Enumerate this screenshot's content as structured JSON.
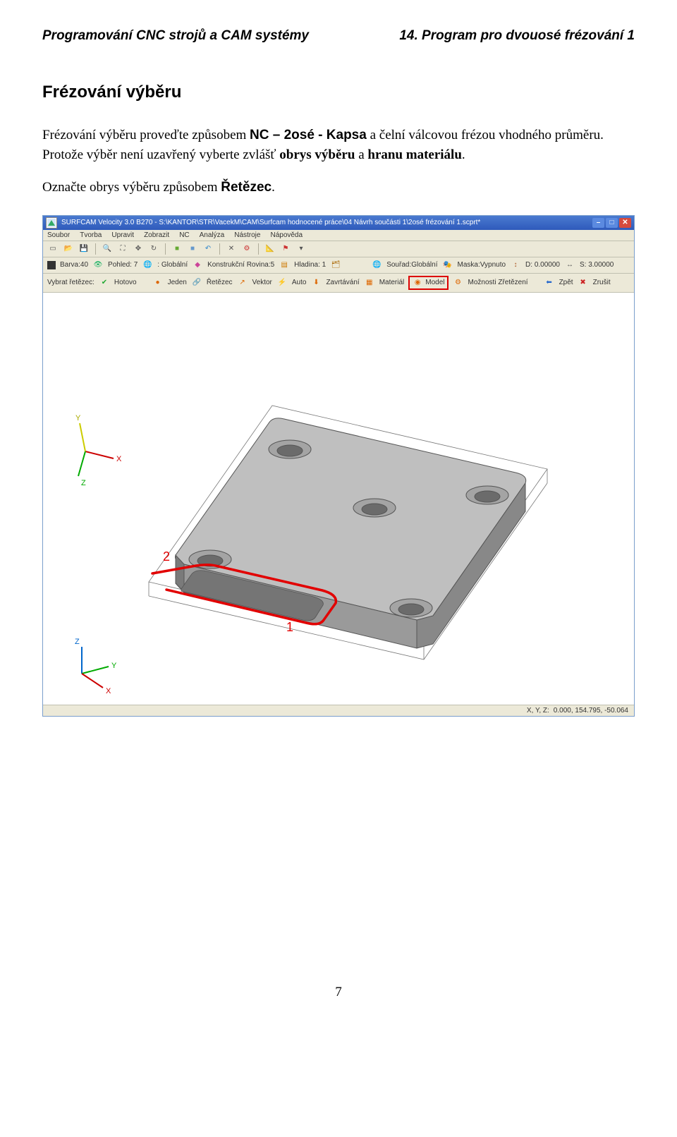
{
  "doc": {
    "header_left": "Programování CNC strojů a CAM systémy",
    "header_right": "14. Program pro dvouosé frézování 1",
    "section_title": "Frézování výběru",
    "p1_a": "Frézování výběru proveďte způsobem ",
    "p1_b": "NC – 2osé - Kapsa",
    "p1_c": " a čelní válcovou frézou vhodného průměru. Protože výběr není uzavřený vyberte zvlášť ",
    "p1_d": "obrys výběru",
    "p1_e": " a ",
    "p1_f": "hranu materiálu",
    "p1_g": ".",
    "p2_a": "Označte obrys výběru způsobem ",
    "p2_b": "Řetězec",
    "p2_c": ".",
    "page_number": "7"
  },
  "app": {
    "title": "SURFCAM Velocity 3.0 B270 - S:\\KANTOR\\STR\\VacekM\\CAM\\Surfcam hodnocené práce\\04 Návrh součásti 1\\2osé frézování 1.scprt*",
    "menus": [
      "Soubor",
      "Tvorba",
      "Upravit",
      "Zobrazit",
      "NC",
      "Analýza",
      "Nástroje",
      "Nápověda"
    ],
    "tb2": {
      "barva": "Barva:40",
      "pohled": "Pohled: 7",
      "globalni": ": Globální",
      "rovina": "Konstrukční Rovina:5",
      "hladina": "Hladina: 1",
      "sourad": "Souřad:Globální",
      "maska": "Maska:Vypnuto",
      "d": "D: 0.00000",
      "s": "S: 3.00000"
    },
    "tb3": {
      "label": "Vybrat řetězec:",
      "hotovo": "Hotovo",
      "jeden": "Jeden",
      "retezec": "Řetězec",
      "vektor": "Vektor",
      "auto": "Auto",
      "zavrtavani": "Zavrtávání",
      "material": "Materiál",
      "model": "Model",
      "moznosti": "Možnosti Zřetězení",
      "zpet": "Zpět",
      "zrusit": "Zrušit"
    },
    "status_label": "X, Y, Z:",
    "status_val": "0.000, 154.795, -50.064",
    "annotation_1": "1",
    "annotation_2": "2"
  },
  "chart_data": {
    "type": "diagram",
    "description": "3D isometric CAD view of a rectangular gray plate with rounded corners and five countersunk holes, plus an open rounded slot on the lower-left edge. A red chain highlights the slot profile with labeled points 1 (slot bottom) and 2 (material edge). Axis triads XYZ shown at lower-left and center-left.",
    "axis_triads": [
      {
        "pos": "center-left",
        "axes": [
          "X",
          "Y",
          "Z"
        ]
      },
      {
        "pos": "lower-left",
        "axes": [
          "X",
          "Y",
          "Z"
        ]
      }
    ]
  }
}
